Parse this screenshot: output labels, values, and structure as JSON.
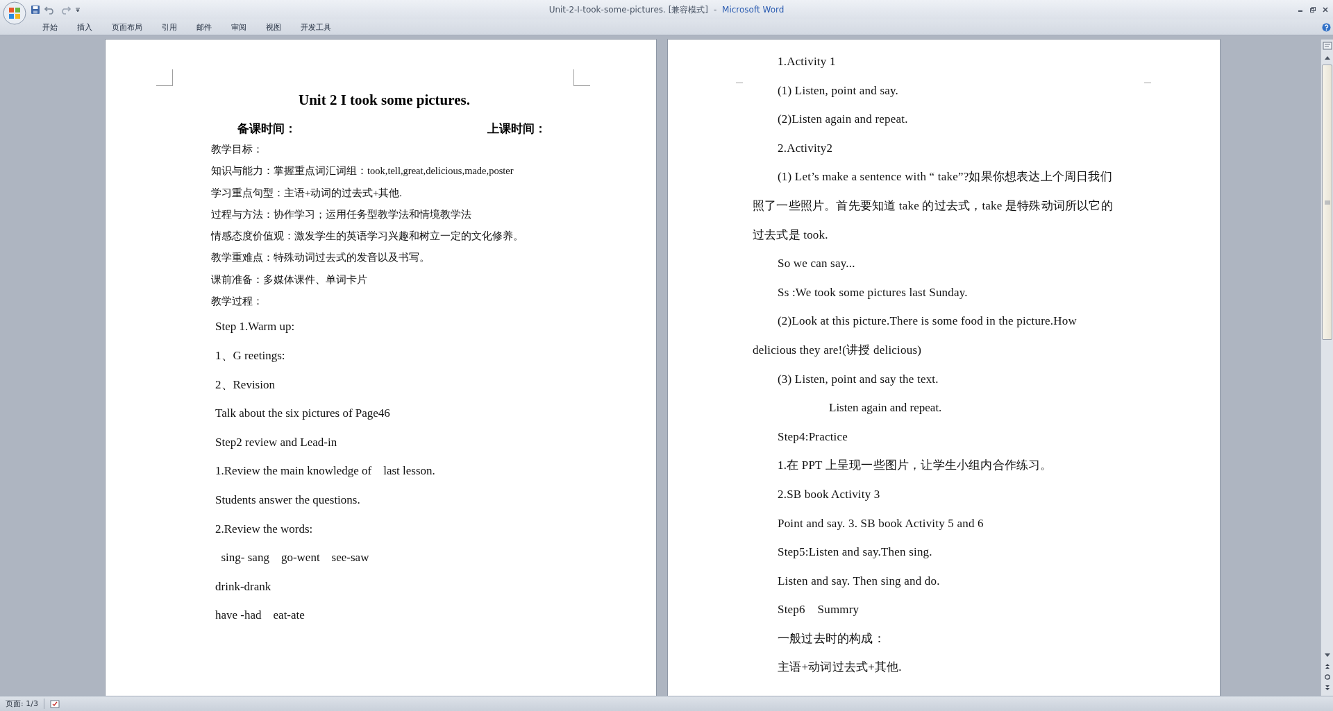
{
  "window": {
    "title": "Unit-2-I-took-some-pictures. [兼容模式]",
    "separator": "-",
    "app_name": "Microsoft Word"
  },
  "ribbon_tabs": [
    {
      "label": "开始",
      "selected": false
    },
    {
      "label": "插入",
      "selected": false
    },
    {
      "label": "页面布局",
      "selected": false
    },
    {
      "label": "引用",
      "selected": false
    },
    {
      "label": "邮件",
      "selected": false
    },
    {
      "label": "审阅",
      "selected": false
    },
    {
      "label": "视图",
      "selected": false
    },
    {
      "label": "开发工具",
      "selected": false
    }
  ],
  "left_page": {
    "title": "Unit 2 I took some pictures.",
    "prep_time_label": "备课时间：",
    "class_time_label": "上课时间：",
    "paragraphs": [
      {
        "kind": "compact",
        "text": "教学目标："
      },
      {
        "kind": "compact",
        "text": "知识与能力：掌握重点词汇词组：took,tell,great,delicious,made,poster"
      },
      {
        "kind": "compact",
        "text": "学习重点句型：主语+动词的过去式+其他."
      },
      {
        "kind": "compact",
        "text": "过程与方法：协作学习；运用任务型教学法和情境教学法"
      },
      {
        "kind": "compact",
        "text": "情感态度价值观：激发学生的英语学习兴趣和树立一定的文化修养。"
      },
      {
        "kind": "compact",
        "text": "教学重难点：特殊动词过去式的发音以及书写。"
      },
      {
        "kind": "compact",
        "text": "课前准备：多媒体课件、单词卡片"
      },
      {
        "kind": "compact",
        "text": "教学过程："
      },
      {
        "kind": "spaced",
        "text": "Step 1.Warm up:"
      },
      {
        "kind": "spaced",
        "text": "1、G reetings:"
      },
      {
        "kind": "spaced",
        "text": "2、Revision"
      },
      {
        "kind": "spaced",
        "text": "Talk about the six pictures of Page46"
      },
      {
        "kind": "spaced",
        "text": "Step2 review and Lead-in"
      },
      {
        "kind": "spaced",
        "text": "1.Review the main knowledge of    last lesson."
      },
      {
        "kind": "spaced",
        "text": "Students answer the questions."
      },
      {
        "kind": "spaced",
        "text": "2.Review the words:"
      },
      {
        "kind": "spaced",
        "text": "  sing- sang    go-went    see-saw"
      },
      {
        "kind": "spaced",
        "text": "drink-drank"
      },
      {
        "kind": "spaced",
        "text": "have -had    eat-ate"
      }
    ]
  },
  "right_page": {
    "paragraphs": [
      {
        "kind": "indent",
        "text": "1.Activity 1"
      },
      {
        "kind": "indent",
        "text": "(1) Listen, point and say."
      },
      {
        "kind": "indent",
        "text": "(2)Listen again and repeat."
      },
      {
        "kind": "indent",
        "text": "2.Activity2"
      },
      {
        "kind": "indent",
        "text": "(1) Let’s make a sentence with “ take”?如果你想表达上个周日我们照了一些照片。首先要知道 take 的过去式，take 是特殊动词所以它的过去式是 took."
      },
      {
        "kind": "indent",
        "text": "So we can say..."
      },
      {
        "kind": "indent",
        "text": "Ss :We took some pictures last Sunday."
      },
      {
        "kind": "indent",
        "text": "(2)Look at this picture.There is some food in the picture.How delicious they are!(讲授 delicious)"
      },
      {
        "kind": "indent",
        "text": "(3) Listen, point and say the text."
      },
      {
        "kind": "deep",
        "text": "Listen again and repeat."
      },
      {
        "kind": "indent",
        "text": "Step4:Practice"
      },
      {
        "kind": "indent",
        "text": "1.在 PPT 上呈现一些图片，让学生小组内合作练习。"
      },
      {
        "kind": "indent",
        "text": "2.SB book Activity 3"
      },
      {
        "kind": "indent",
        "text": "Point and say. 3. SB book Activity 5 and 6"
      },
      {
        "kind": "indent",
        "text": "Step5:Listen and say.Then sing."
      },
      {
        "kind": "indent",
        "text": "Listen and say. Then sing and do."
      },
      {
        "kind": "indent",
        "text": "Step6    Summry"
      },
      {
        "kind": "indent",
        "text": "一般过去时的构成："
      },
      {
        "kind": "indent",
        "text": "主语+动词过去式+其他."
      }
    ]
  },
  "status_bar": {
    "page": "页面: 1/3"
  }
}
